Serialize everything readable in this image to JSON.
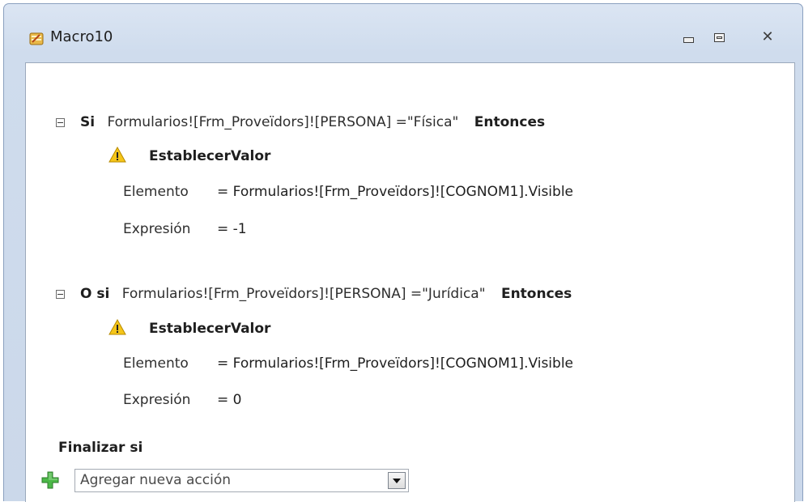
{
  "window": {
    "title": "Macro10",
    "icon": "macro-scroll-icon",
    "controls": [
      "minimize-icon",
      "restore-icon",
      "close-icon"
    ]
  },
  "blocks": [
    {
      "keyword": "Si",
      "condition": "Formularios![Frm_Proveïdors]![PERSONA] =\"Física\"",
      "then_label": "Entonces",
      "action": {
        "icon": "warning-icon",
        "name": "EstablecerValor",
        "args": [
          {
            "label": "Elemento",
            "value": "= Formularios![Frm_Proveïdors]![COGNOM1].Visible"
          },
          {
            "label": "Expresión",
            "value": "= -1"
          }
        ]
      }
    },
    {
      "keyword": "O si",
      "condition": "Formularios![Frm_Proveïdors]![PERSONA] =\"Jurídica\"",
      "then_label": "Entonces",
      "action": {
        "icon": "warning-icon",
        "name": "EstablecerValor",
        "args": [
          {
            "label": "Elemento",
            "value": "= Formularios![Frm_Proveïdors]![COGNOM1].Visible"
          },
          {
            "label": "Expresión",
            "value": "= 0"
          }
        ]
      }
    }
  ],
  "end_if_label": "Finalizar si",
  "add_action": {
    "icon": "green-plus-icon",
    "value": "Agregar nueva acción"
  }
}
